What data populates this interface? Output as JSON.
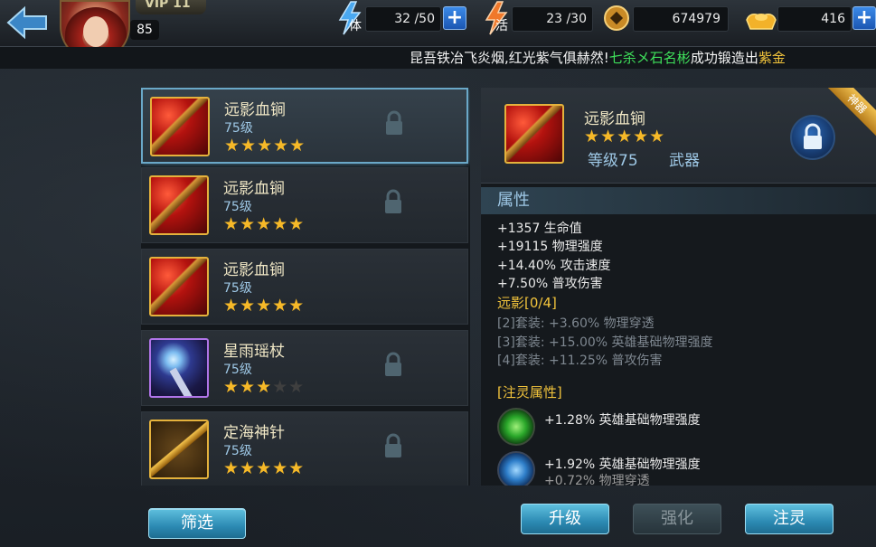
{
  "player": {
    "vip": "VIP 11",
    "level": "85"
  },
  "resources": {
    "stamina_label": "体",
    "stamina": "32 /50",
    "activity_label": "活",
    "activity": "23 /30",
    "coins": "674979",
    "gold": "416"
  },
  "ticker": {
    "part1": "昆吾铁冶飞炎烟,红光紫气俱赫然!",
    "player": "七杀メ石名彬",
    "part2": "成功锻造出",
    "item": "紫金"
  },
  "list": [
    {
      "name": "远影血锏",
      "level": "75级",
      "stars": 5,
      "max_stars": 5,
      "locked": true
    },
    {
      "name": "远影血锏",
      "level": "75级",
      "stars": 5,
      "max_stars": 5,
      "locked": true
    },
    {
      "name": "远影血锏",
      "level": "75级",
      "stars": 5,
      "max_stars": 5,
      "locked": false
    },
    {
      "name": "星雨瑶杖",
      "level": "75级",
      "stars": 3,
      "max_stars": 5,
      "locked": true
    },
    {
      "name": "定海神针",
      "level": "75级",
      "stars": 5,
      "max_stars": 5,
      "locked": true
    }
  ],
  "filter_label": "筛选",
  "detail": {
    "name": "远影血锏",
    "stars": 5,
    "level": "等级75",
    "type": "武器",
    "ribbon": "神器",
    "section_title": "属性",
    "attributes": [
      "+1357 生命值",
      "+19115 物理强度",
      "+14.40% 攻击速度",
      "+7.50% 普攻伤害"
    ],
    "set_title": "远影[0/4]",
    "set_bonuses": [
      "[2]套装: +3.60% 物理穿透",
      "[3]套装: +15.00% 英雄基础物理强度",
      "[4]套装: +11.25% 普攻伤害"
    ],
    "infuse_title": "[注灵属性]",
    "infuse": [
      "+1.28% 英雄基础物理强度",
      "+1.92% 英雄基础物理强度"
    ],
    "infuse_partial": "+0.72% 物理穿透"
  },
  "buttons": {
    "upgrade": "升级",
    "enhance": "强化",
    "infuse": "注灵"
  },
  "colors": {
    "star": "#f6b928",
    "accent_blue": "#2c8ab3",
    "gold_text": "#f2c43c",
    "green_text": "#3fe05b"
  }
}
